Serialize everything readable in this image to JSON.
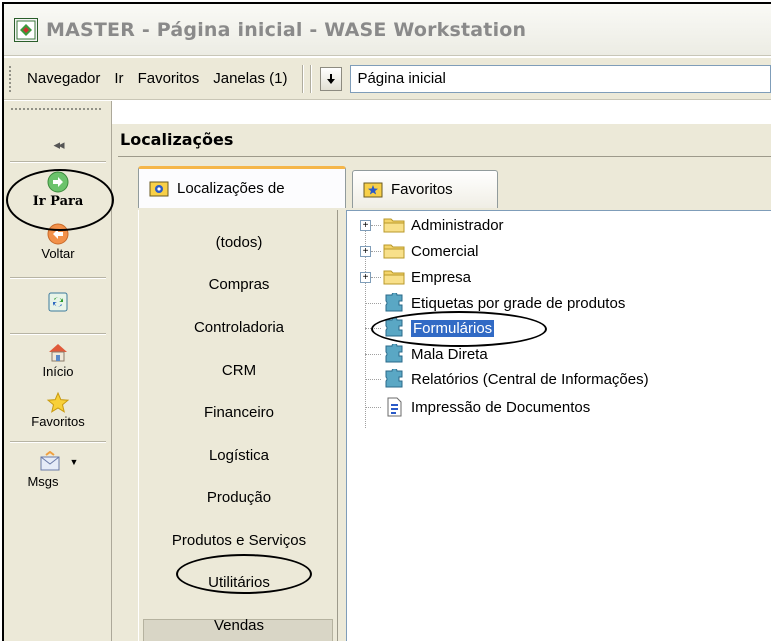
{
  "window": {
    "title": "MASTER - Página inicial - WASE Workstation"
  },
  "menubar": {
    "items": [
      "Navegador",
      "Ir",
      "Favoritos",
      "Janelas (1)"
    ],
    "address_value": "Página inicial"
  },
  "left_toolbar": {
    "collapse": "◂◂",
    "buttons": [
      {
        "label": "Ir Para",
        "icon": "go-arrow-icon"
      },
      {
        "label": "Voltar",
        "icon": "back-arrow-icon"
      },
      {
        "label": "",
        "icon": "refresh-icon"
      },
      {
        "label": "Início",
        "icon": "home-icon"
      },
      {
        "label": "Favoritos",
        "icon": "star-icon"
      },
      {
        "label": "Msgs",
        "icon": "envelope-icon"
      }
    ]
  },
  "panel": {
    "title": "Localizações",
    "tabs": [
      "Localizações de",
      "Favoritos"
    ],
    "categories": [
      "(todos)",
      "Compras",
      "Controladoria",
      "CRM",
      "Financeiro",
      "Logística",
      "Produção",
      "Produtos e Serviços",
      "Utilitários",
      "Vendas"
    ],
    "selected_category": "Utilitários",
    "tree": [
      {
        "label": "Administrador",
        "type": "folder",
        "expandable": true
      },
      {
        "label": "Comercial",
        "type": "folder",
        "expandable": true
      },
      {
        "label": "Empresa",
        "type": "folder",
        "expandable": true
      },
      {
        "label": "Etiquetas por grade de produtos",
        "type": "puzzle",
        "expandable": false
      },
      {
        "label": "Formulários",
        "type": "puzzle",
        "expandable": false,
        "selected": true
      },
      {
        "label": "Mala Direta",
        "type": "puzzle",
        "expandable": false
      },
      {
        "label": "Relatórios (Central de Informações)",
        "type": "puzzle",
        "expandable": false
      },
      {
        "label": "Impressão de Documentos",
        "type": "document",
        "expandable": false
      }
    ]
  },
  "colors": {
    "chrome": "#ece9d8",
    "selection": "#316ac5",
    "folder": "#f4d46a",
    "puzzle": "#5aa7c4"
  }
}
